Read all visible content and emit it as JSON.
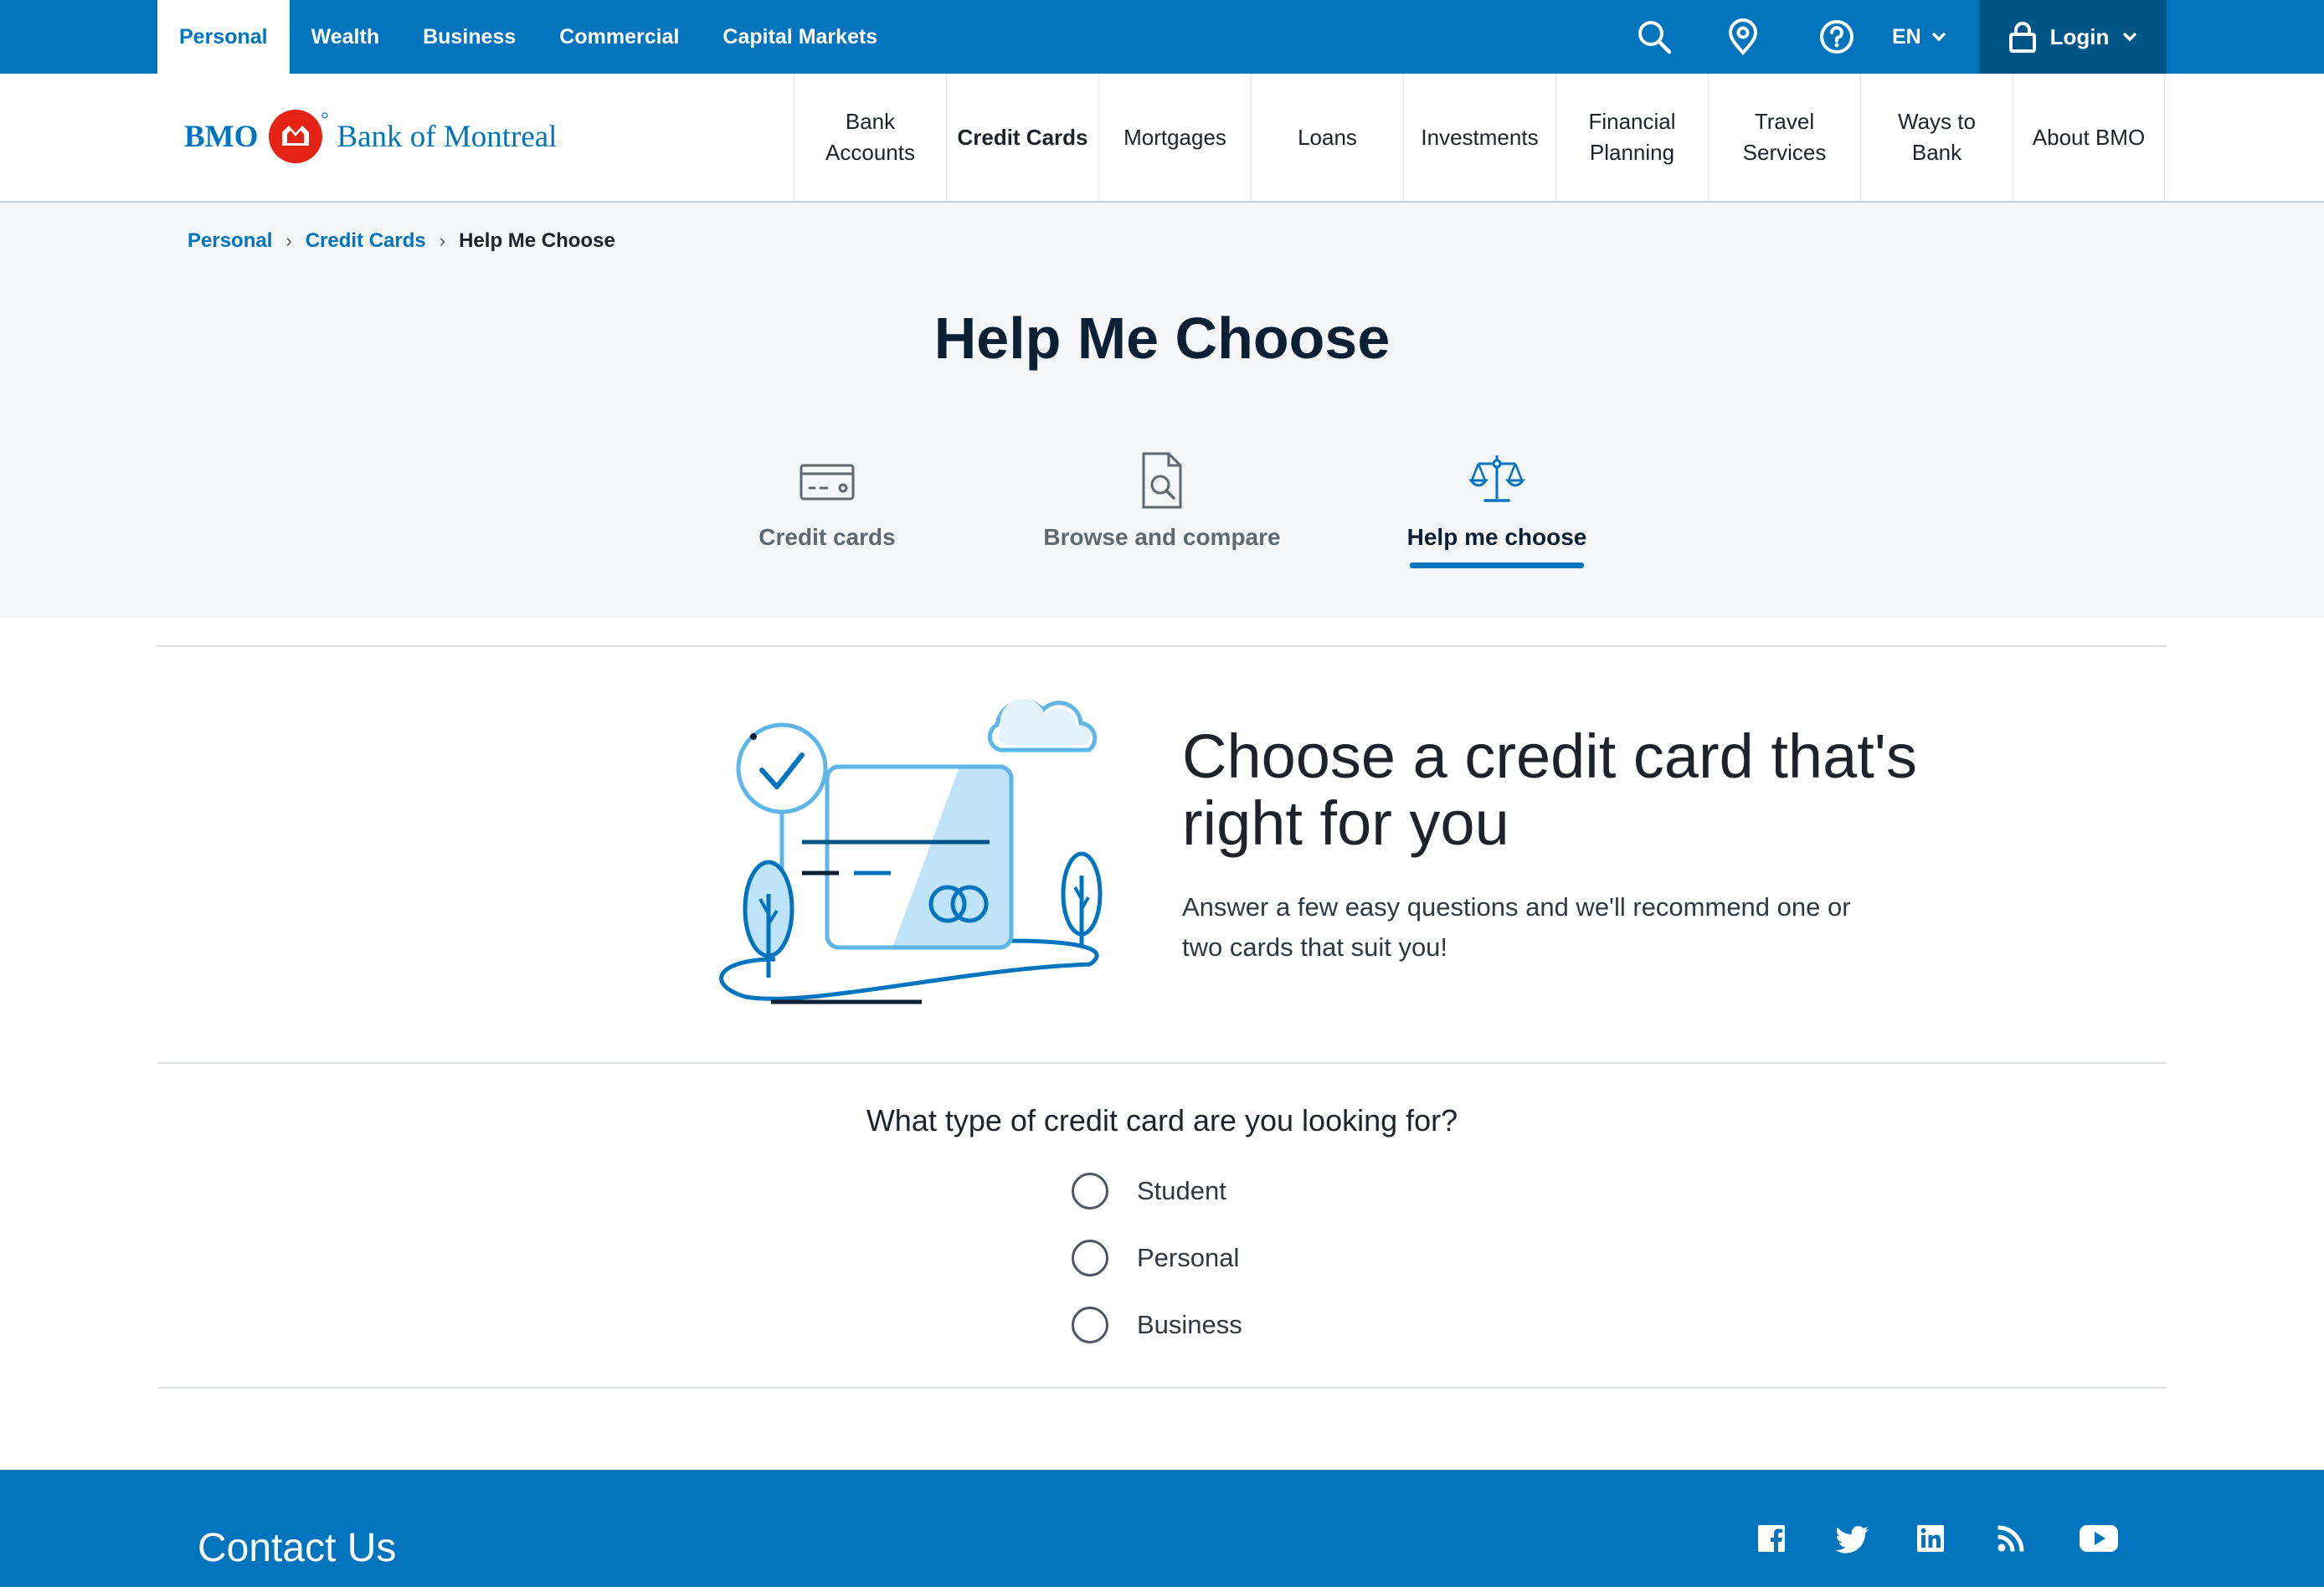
{
  "top_nav": {
    "tabs": [
      {
        "label": "Personal",
        "active": true
      },
      {
        "label": "Wealth",
        "active": false
      },
      {
        "label": "Business",
        "active": false
      },
      {
        "label": "Commercial",
        "active": false
      },
      {
        "label": "Capital Markets",
        "active": false
      }
    ],
    "icons": [
      "search-icon",
      "location-pin-icon",
      "help-icon"
    ],
    "language": "EN",
    "login_label": "Login"
  },
  "header": {
    "logo": {
      "left_text": "BMO",
      "right_text": "Bank of Montreal"
    },
    "nav": [
      {
        "label": "Bank\nAccounts",
        "active": false
      },
      {
        "label": "Credit Cards",
        "active": true
      },
      {
        "label": "Mortgages",
        "active": false
      },
      {
        "label": "Loans",
        "active": false
      },
      {
        "label": "Investments",
        "active": false
      },
      {
        "label": "Financial\nPlanning",
        "active": false
      },
      {
        "label": "Travel\nServices",
        "active": false
      },
      {
        "label": "Ways to\nBank",
        "active": false
      },
      {
        "label": "About BMO",
        "active": false
      }
    ]
  },
  "breadcrumb": {
    "items": [
      "Personal",
      "Credit Cards"
    ],
    "current": "Help Me Choose"
  },
  "page": {
    "title": "Help Me Choose"
  },
  "section_tabs": [
    {
      "label": "Credit cards",
      "icon": "credit-card-icon",
      "active": false
    },
    {
      "label": "Browse and compare",
      "icon": "document-search-icon",
      "active": false
    },
    {
      "label": "Help me choose",
      "icon": "scales-icon",
      "active": true
    }
  ],
  "promo": {
    "title": "Choose a credit card that's right for you",
    "subtitle": "Answer a few easy questions and we'll recommend one or two cards that suit you!",
    "illustration": "credit-card-illustration"
  },
  "question": {
    "text": "What type of credit card are you looking for?",
    "options": [
      "Student",
      "Personal",
      "Business"
    ],
    "selected": null
  },
  "footer": {
    "contact_label": "Contact Us",
    "social": [
      "facebook-icon",
      "twitter-icon",
      "linkedin-icon",
      "rss-icon",
      "youtube-icon"
    ]
  },
  "colors": {
    "brand_blue": "#0075be",
    "brand_dark_blue": "#005587",
    "brand_red": "#e42314",
    "hero_bg": "#f5f6f7",
    "text_dark": "#0b1f35"
  }
}
